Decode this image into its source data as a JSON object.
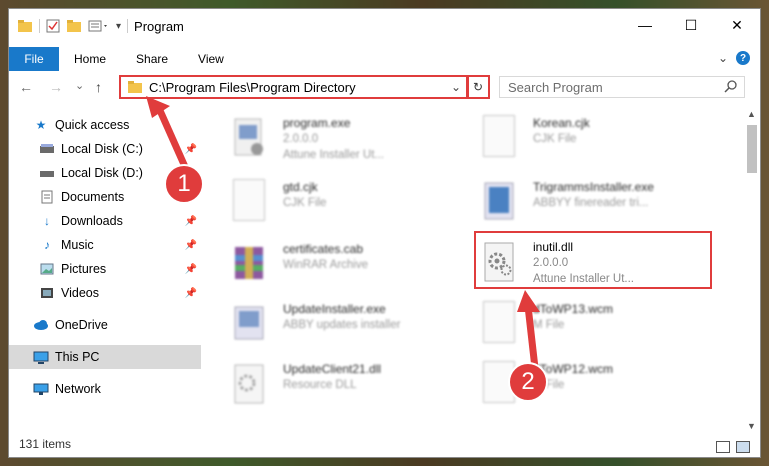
{
  "window": {
    "title": "Program",
    "controls": {
      "minimize": "—",
      "maximize": "☐",
      "close": "✕"
    }
  },
  "ribbon": {
    "tabs": [
      "File",
      "Home",
      "Share",
      "View"
    ]
  },
  "navigation": {
    "back": "←",
    "forward": "→",
    "recent": "⌄",
    "up": "↑",
    "address": "C:\\Program Files\\Program Directory",
    "search_placeholder": "Search Program"
  },
  "sidebar": {
    "items": [
      {
        "label": "Quick access",
        "icon": "star-icon"
      },
      {
        "label": "Local Disk (C:)",
        "icon": "drive-icon",
        "pinned": true
      },
      {
        "label": "Local Disk (D:)",
        "icon": "drive-icon",
        "pinned": true
      },
      {
        "label": "Documents",
        "icon": "documents-icon",
        "pinned": true
      },
      {
        "label": "Downloads",
        "icon": "downloads-icon",
        "pinned": true
      },
      {
        "label": "Music",
        "icon": "music-icon",
        "pinned": true
      },
      {
        "label": "Pictures",
        "icon": "pictures-icon",
        "pinned": true
      },
      {
        "label": "Videos",
        "icon": "videos-icon",
        "pinned": true
      },
      {
        "label": "OneDrive",
        "icon": "cloud-icon"
      },
      {
        "label": "This PC",
        "icon": "pc-icon",
        "selected": true
      },
      {
        "label": "Network",
        "icon": "network-icon"
      }
    ]
  },
  "files": [
    {
      "name": "program.exe",
      "line2": "2.0.0.0",
      "line3": "Attune Installer Ut...",
      "icon": "exe-icon"
    },
    {
      "name": "Korean.cjk",
      "line2": "CJK File",
      "line3": "",
      "icon": "document-icon"
    },
    {
      "name": "gtd.cjk",
      "line2": "CJK File",
      "line3": "",
      "icon": "document-icon"
    },
    {
      "name": "TrigrammsInstaller.exe",
      "line2": "ABBYY finereader tri...",
      "line3": "",
      "icon": "exe-icon"
    },
    {
      "name": "certificates.cab",
      "line2": "WinRAR Archive",
      "line3": "",
      "icon": "archive-icon"
    },
    {
      "name": "inutil.dll",
      "line2": "2.0.0.0",
      "line3": "Attune Installer Ut...",
      "icon": "dll-gear-icon"
    },
    {
      "name": "UpdateInstaller.exe",
      "line2": "ABBY updates installer",
      "line3": "",
      "icon": "exe-icon"
    },
    {
      "name": "dToWP13.wcm",
      "line2": "M File",
      "line3": "",
      "icon": "document-icon"
    },
    {
      "name": "UpdateClient21.dll",
      "line2": "Resource DLL",
      "line3": "",
      "icon": "dll-gear-icon"
    },
    {
      "name": "dToWP12.wcm",
      "line2": "M File",
      "line3": "",
      "icon": "document-icon"
    }
  ],
  "status": {
    "item_count": "131 items"
  },
  "callouts": {
    "one": "1",
    "two": "2"
  },
  "colors": {
    "accent": "#1979ca",
    "highlight": "#e03c3c"
  }
}
